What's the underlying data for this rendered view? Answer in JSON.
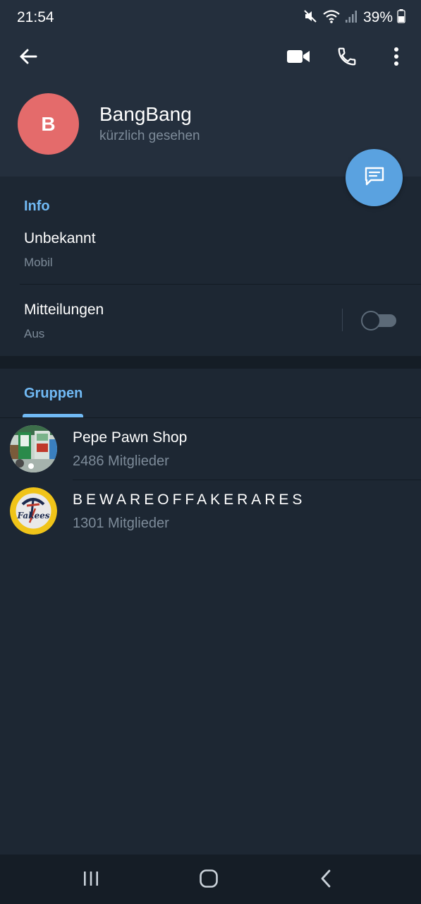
{
  "status_bar": {
    "time": "21:54",
    "battery_percent": "39%",
    "icons": [
      "mute-icon",
      "wifi-icon",
      "signal-icon",
      "battery-icon"
    ]
  },
  "toolbar": {
    "icons": [
      "back-arrow-icon",
      "video-camera-icon",
      "phone-icon",
      "more-vertical-icon"
    ]
  },
  "profile": {
    "avatar_letter": "B",
    "avatar_color": "#e46b6b",
    "name": "BangBang",
    "status": "kürzlich gesehen"
  },
  "fab": {
    "icon": "message-icon",
    "color": "#5aa2e0"
  },
  "info": {
    "section_title": "Info",
    "phone": {
      "value": "Unbekannt",
      "label": "Mobil"
    },
    "notifications": {
      "title": "Mitteilungen",
      "value": "Aus",
      "toggle_on": false
    }
  },
  "groups": {
    "tab_label": "Gruppen",
    "items": [
      {
        "name": "Pepe Pawn Shop",
        "members": "2486 Mitglieder"
      },
      {
        "name": "BEWAREOFFAKERARES",
        "members": "1301 Mitglieder",
        "avatar_text": "Fakees"
      }
    ]
  },
  "nav_bar": {
    "icons": [
      "recent-apps-icon",
      "home-icon",
      "back-icon"
    ]
  },
  "colors": {
    "background": "#1d2733",
    "header": "#242f3d",
    "accent": "#71baf5",
    "secondary_text": "#7d8b99"
  }
}
